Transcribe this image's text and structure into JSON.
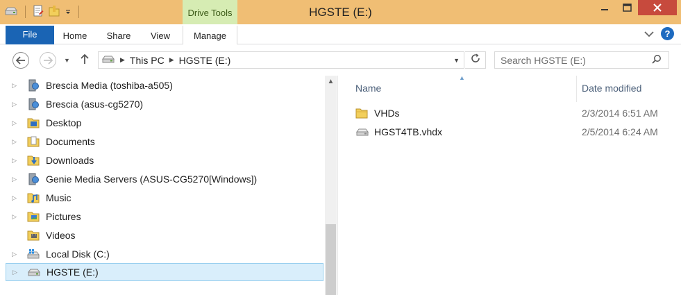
{
  "window": {
    "title": "HGSTE (E:)",
    "contextual_tab_group": "Drive Tools",
    "close_color": "#c74a3d",
    "titlebar_color": "#f0be74"
  },
  "quick_access": {
    "icons": [
      "drive-icon",
      "properties-icon",
      "new-folder-icon",
      "customize-dropdown-icon"
    ]
  },
  "ribbon": {
    "file_label": "File",
    "tabs": [
      "Home",
      "Share",
      "View",
      "Manage"
    ]
  },
  "address": {
    "path": [
      "This PC",
      "HGSTE (E:)"
    ],
    "search_placeholder": "Search HGSTE (E:)"
  },
  "nav_items": [
    {
      "label": "Brescia  Media (toshiba-a505)",
      "icon": "media-server-icon"
    },
    {
      "label": "Brescia (asus-cg5270)",
      "icon": "media-server-icon"
    },
    {
      "label": "Desktop",
      "icon": "desktop-folder-icon"
    },
    {
      "label": "Documents",
      "icon": "documents-folder-icon"
    },
    {
      "label": "Downloads",
      "icon": "downloads-folder-icon"
    },
    {
      "label": "Genie Media Servers (ASUS-CG5270[Windows])",
      "icon": "media-server-icon"
    },
    {
      "label": "Music",
      "icon": "music-folder-icon"
    },
    {
      "label": "Pictures",
      "icon": "pictures-folder-icon"
    },
    {
      "label": "Videos",
      "icon": "videos-folder-icon"
    },
    {
      "label": "Local Disk (C:)",
      "icon": "windows-drive-icon"
    },
    {
      "label": "HGSTE (E:)",
      "icon": "drive-icon",
      "selected": true
    }
  ],
  "columns": {
    "name": "Name",
    "date_modified": "Date modified"
  },
  "files": [
    {
      "name": "VHDs",
      "date": "2/3/2014 6:51 AM",
      "icon": "folder-icon"
    },
    {
      "name": "HGST4TB.vhdx",
      "date": "2/5/2014 6:24 AM",
      "icon": "vhd-drive-icon"
    }
  ]
}
